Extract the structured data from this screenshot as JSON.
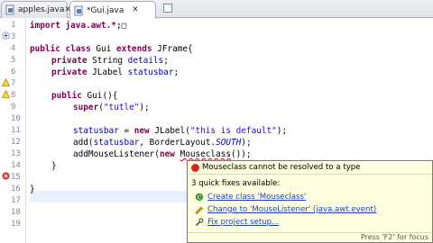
{
  "tabs": [
    {
      "label": "apples.java",
      "close": "✕"
    },
    {
      "label": "*Gui.java",
      "close": "✕"
    }
  ],
  "line_numbers": [
    "1",
    "3",
    "4",
    "5",
    "6",
    "7",
    "8",
    "9",
    "10",
    "11",
    "12",
    "13",
    "14",
    "15",
    "16",
    "17",
    "18",
    "19"
  ],
  "code": {
    "l1": [
      "import java.awt.*;",
      "□"
    ],
    "l4": [
      "public",
      " ",
      "class",
      " Gui ",
      "extends",
      " JFrame{"
    ],
    "l5": [
      "private",
      " String ",
      "details",
      ";"
    ],
    "l6": [
      "private",
      " JLabel ",
      "statusbar",
      ";"
    ],
    "l8": [
      "public",
      " Gui(){"
    ],
    "l9": [
      "super",
      "(",
      "\"tutle\"",
      ");"
    ],
    "l11": [
      "statusbar",
      " = ",
      "new",
      " JLabel(",
      "\"this is default\"",
      ");"
    ],
    "l12": [
      "add(",
      "statusbar",
      ", BorderLayout.",
      "SOUTH",
      ");"
    ],
    "l13": [
      "addMouseListener(",
      "new",
      " ",
      "Mouseclass",
      "());"
    ],
    "l14": [
      "}"
    ],
    "l16": [
      "}"
    ]
  },
  "popup": {
    "title": "Mouseclass cannot be resolved to a type",
    "subtitle": "3 quick fixes available:",
    "fixes": [
      "Create class 'Mouseclass'",
      "Change to 'MouseListener' (java.awt.event)",
      "Fix project setup..."
    ],
    "footer": "Press 'F2' for focus"
  },
  "colors": {
    "keyword": "#7f0055",
    "string": "#2a00ff",
    "field": "#0000c0",
    "error": "#e0001a",
    "popup_bg": "#ffffe1"
  }
}
